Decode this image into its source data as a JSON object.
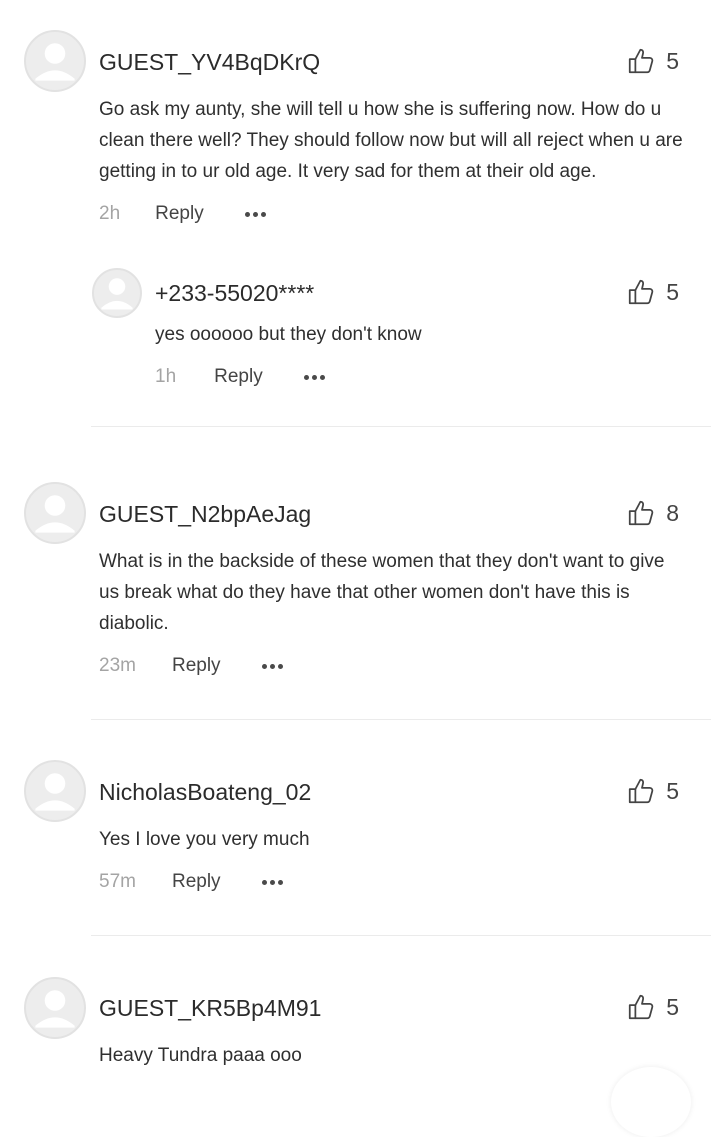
{
  "comments": [
    {
      "username": "GUEST_YV4BqDKrQ",
      "likes": "5",
      "text": "Go ask my aunty, she will tell u how she is suffering  now. How do u clean there well? They should  follow  now but will all reject when u are getting in to ur old age. It very sad for them at their old age.",
      "time": "2h",
      "reply_label": "Reply"
    },
    {
      "username": "+233-55020****",
      "likes": "5",
      "text": "yes oooooo but they don't know",
      "time": "1h",
      "reply_label": "Reply"
    },
    {
      "username": "GUEST_N2bpAeJag",
      "likes": "8",
      "text": "What is in the backside of these women that they don't want to give us break what do they have that other women don't have this is diabolic.",
      "time": "23m",
      "reply_label": "Reply"
    },
    {
      "username": "NicholasBoateng_02",
      "likes": "5",
      "text": "Yes I love you very much",
      "time": "57m",
      "reply_label": "Reply"
    },
    {
      "username": "GUEST_KR5Bp4M91",
      "likes": "5",
      "text": "Heavy Tundra paaa ooo"
    }
  ],
  "icons": {
    "like": "thumbs-up-icon",
    "more": "more-options-icon",
    "avatar": "default-avatar-icon"
  },
  "colors": {
    "background": "#ffffff",
    "text": "#2f2f2f",
    "muted": "#a4a4a4",
    "avatar": "#ededed"
  }
}
